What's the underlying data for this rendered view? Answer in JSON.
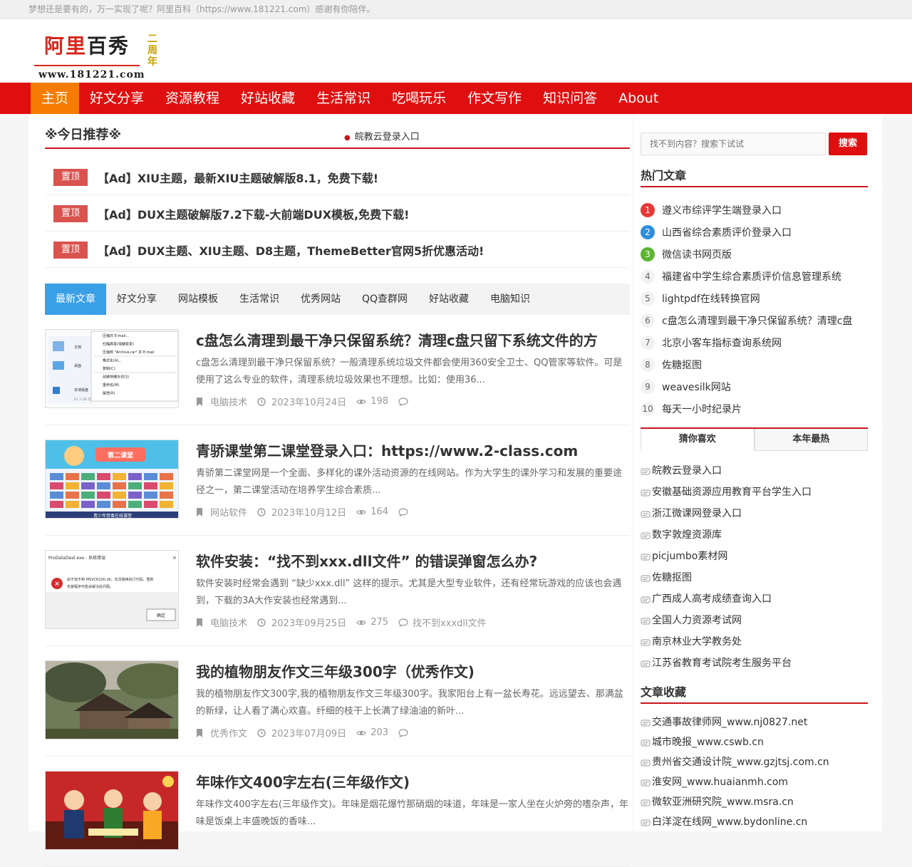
{
  "topbar": {
    "text": "梦想还是要有的，万一实现了呢？阿里百科（https://www.181221.com）感谢有你陪伴。"
  },
  "logo": {
    "brand_red": "阿里",
    "brand_black": "百秀",
    "url": "www.181221.com",
    "year": "二周年"
  },
  "nav": {
    "items": [
      "主页",
      "好文分享",
      "资源教程",
      "好站收藏",
      "生活常识",
      "吃喝玩乐",
      "作文写作",
      "知识问答",
      "About"
    ]
  },
  "today": {
    "title": "※今日推荐※",
    "marquee": "皖教云登录入口"
  },
  "pins": {
    "badge": "置顶",
    "items": [
      "【Ad】XIU主题，最新XIU主题破解版8.1，免费下载!",
      "【Ad】DUX主题破解版7.2下载-大前端DUX模板,免费下载!",
      "【Ad】DUX主题、XIU主题、D8主题，ThemeBetter官网5折优惠活动!"
    ]
  },
  "tabs": [
    "最新文章",
    "好文分享",
    "网站模板",
    "生活常识",
    "优秀网站",
    "QQ查群网",
    "好站收藏",
    "电脑知识"
  ],
  "posts": [
    {
      "title": "c盘怎么清理到最干净只保留系统？清理c盘只留下系统文件的方",
      "excerpt": "c盘怎么清理到最干净只保留系统？一般清理系统垃圾文件都会使用360安全卫士、QQ管家等软件。可是使用了这么专业的软件，清理系统垃圾效果也不理想。比如：使用36...",
      "category": "电脑技术",
      "date": "2023年10月24日",
      "views": "198",
      "tag": ""
    },
    {
      "title": "青骄课堂第二课堂登录入口：https://www.2-class.com",
      "excerpt": "青骄第二课堂网是一个全面、多样化的课外活动资源的在线网站。作为大学生的课外学习和发展的重要途径之一，第二课堂活动在培养学生综合素质...",
      "category": "网站软件",
      "date": "2023年10月12日",
      "views": "164",
      "tag": ""
    },
    {
      "title": "软件安装：“找不到xxx.dll文件” 的错误弹窗怎么办?",
      "excerpt": "软件安装时经常会遇到 “缺少xxx.dll” 这样的提示。尤其是大型专业软件，还有经常玩游戏的应该也会遇到，下载的3A大作安装也经常遇到...",
      "category": "电脑技术",
      "date": "2023年09月25日",
      "views": "275",
      "tag": "找不到xxxdll文件"
    },
    {
      "title": "我的植物朋友作文三年级300字（优秀作文)",
      "excerpt": "我的植物朋友作文300字,我的植物朋友作文三年级300字。我家阳台上有一盆长寿花。远远望去、那满盆的新绿，让人看了满心欢喜。纤细的枝干上长满了绿油油的新叶...",
      "category": "优秀作文",
      "date": "2023年07月09日",
      "views": "203",
      "tag": ""
    },
    {
      "title": "年味作文400字左右(三年级作文)",
      "excerpt": "年味作文400字左右(三年级作文)。年味是烟花爆竹那硝烟的味道，年味是一家人坐在火炉旁的嗜杂声，年味是饭桌上丰盛晚饭的香味...",
      "category": "",
      "date": "",
      "views": "",
      "tag": ""
    }
  ],
  "post_thumb_texts": {
    "menu_items": [
      "压缩并 E-mail...",
      "扫描病毒(电脑管家)",
      "压缩到 \"Archive.rar\" 并 E-mail",
      "格式化(A)...",
      "复制(C)",
      "创建快捷方式(S)",
      "重命名(M)",
      "属性(R)"
    ],
    "explorer_labels": [
      "文档",
      "桌面",
      "本地磁盘",
      "61.7 GB 可用，共 95.4 GB"
    ],
    "dialog_title": "ProDataDeal.exe - 系统错误",
    "dialog_text": "由于找不到 MSVCR100.dll，无法继续执行代码。重新安装程序可能会解决此问题。",
    "dialog_button": "确定",
    "class_banner": "第二课堂",
    "class_footer": "青少年禁毒在线课堂"
  },
  "sidebar": {
    "search_placeholder": "找不到内容？搜索下试试",
    "search_button": "搜索",
    "hot_title": "热门文章",
    "hot": [
      {
        "n": "1",
        "t": "遵义市综评学生端登录入口"
      },
      {
        "n": "2",
        "t": "山西省综合素质评价登录入口"
      },
      {
        "n": "3",
        "t": "微信读书网页版"
      },
      {
        "n": "4",
        "t": "福建省中学生综合素质评价信息管理系统"
      },
      {
        "n": "5",
        "t": "lightpdf在线转换官网"
      },
      {
        "n": "6",
        "t": "c盘怎么清理到最干净只保留系统？清理c盘"
      },
      {
        "n": "7",
        "t": "北京小客车指标查询系统网"
      },
      {
        "n": "8",
        "t": "佐糖抠图"
      },
      {
        "n": "9",
        "t": "weavesilk网站"
      },
      {
        "n": "10",
        "t": "每天一小时纪录片"
      }
    ],
    "tab_guess": "猜你喜欢",
    "tab_year": "本年最热",
    "guess": [
      "皖教云登录入口",
      "安徽基础资源应用教育平台学生入口",
      "浙江微课网登录入口",
      "数字敦煌资源库",
      "picjumbo素材网",
      "佐糖抠图",
      "广西成人高考成绩查询入口",
      "全国人力资源考试网",
      "南京林业大学教务处",
      "江苏省教育考试院考生服务平台"
    ],
    "fav_title": "文章收藏",
    "favs": [
      "交通事故律师网_www.nj0827.net",
      "城市晚报_www.cswb.cn",
      "贵州省交通设计院_www.gzjtsj.com.cn",
      "淮安网_www.huaianmh.com",
      "微软亚洲研究院_www.msra.cn",
      "白洋淀在线网_www.bydonline.cn"
    ]
  },
  "colors": {
    "nav_red": "#e00f0f",
    "nav_active": "#f57c00",
    "tab_active": "#3aa0e6",
    "pin_badge": "#d9534f"
  }
}
